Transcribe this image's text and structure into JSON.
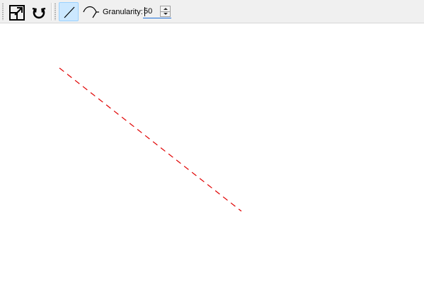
{
  "toolbar": {
    "buttons": [
      {
        "icon": "resize-icon",
        "active": false
      },
      {
        "icon": "refresh-icon",
        "active": false
      },
      {
        "icon": "line-tool-icon",
        "active": true
      },
      {
        "icon": "curve-tool-icon",
        "active": false
      }
    ],
    "granularity_label": "Granularity:",
    "granularity_value": "50"
  },
  "canvas": {
    "line_color": "#e00000",
    "line_style": "dashed"
  }
}
